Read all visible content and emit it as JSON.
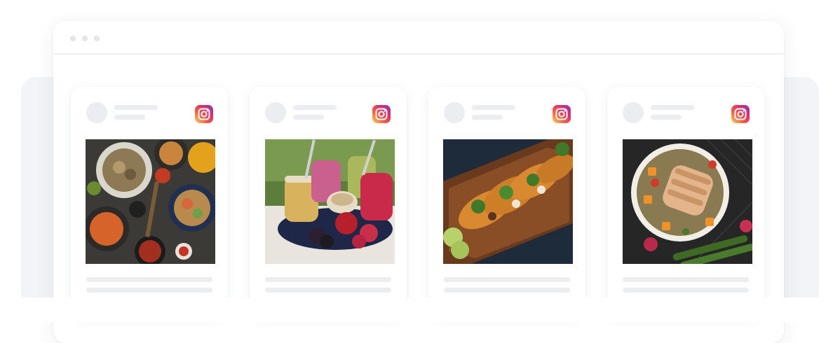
{
  "window": {
    "controls": [
      "dot",
      "dot",
      "dot"
    ]
  },
  "cards": [
    {
      "platform_icon": "instagram-icon",
      "image": "asian-food-spread-photo"
    },
    {
      "platform_icon": "instagram-icon",
      "image": "smoothies-and-berries-photo"
    },
    {
      "platform_icon": "instagram-icon",
      "image": "tacos-on-board-photo"
    },
    {
      "platform_icon": "instagram-icon",
      "image": "chicken-salad-bowl-photo"
    }
  ],
  "colors": {
    "background": "#ffffff",
    "back_panel": "#f3f4f7",
    "placeholder": "#ebedf1",
    "instagram_gradient": [
      "#fdd96c",
      "#f56040",
      "#e1306c",
      "#833ab4"
    ]
  }
}
